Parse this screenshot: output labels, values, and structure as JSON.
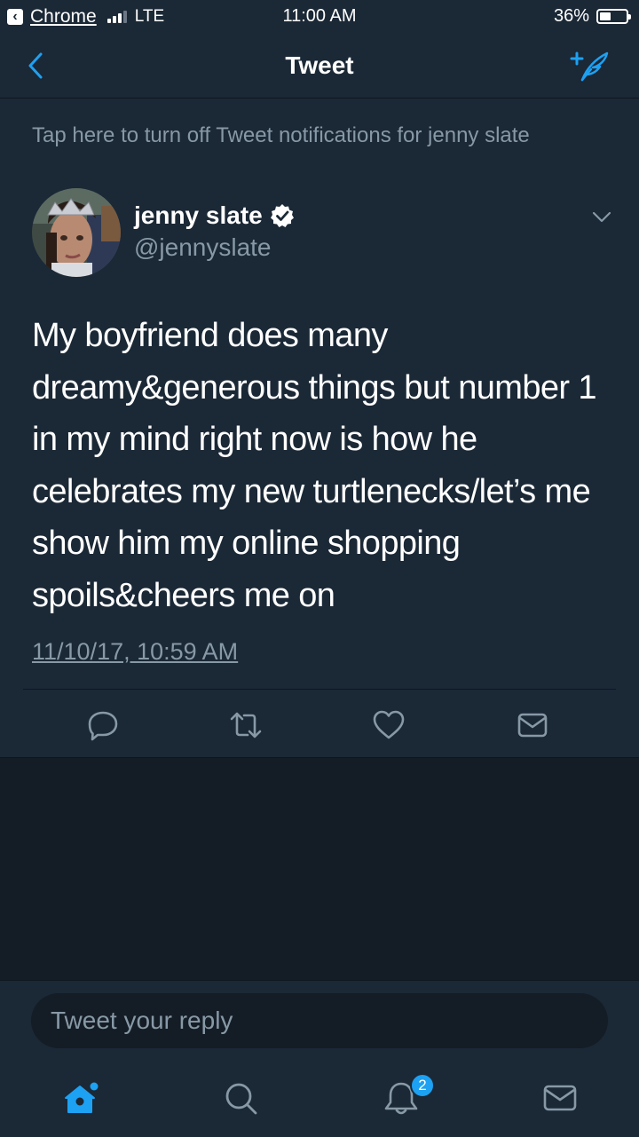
{
  "status_bar": {
    "back_app": "Chrome",
    "carrier": "LTE",
    "time": "11:00 AM",
    "battery": "36%",
    "battery_level": 0.36
  },
  "nav": {
    "title": "Tweet"
  },
  "notification_banner": "Tap here to turn off Tweet notifications for jenny slate",
  "tweet": {
    "author_name": "jenny slate",
    "author_handle": "@jennyslate",
    "text": "My boyfriend does many dreamy&generous things but number 1 in my mind right now is how he celebrates my new turtlenecks/let’s me show him my online shopping spoils&cheers me on",
    "timestamp": "11/10/17, 10:59 AM"
  },
  "reply": {
    "placeholder": "Tweet your reply"
  },
  "tab_bar": {
    "notification_count": "2"
  },
  "colors": {
    "background": "#141d26",
    "surface": "#1b2836",
    "accent": "#1da1f2",
    "secondary_text": "#8899a6"
  },
  "icons": [
    "chevron-left-icon",
    "compose-tweet-icon",
    "verified-badge-icon",
    "chevron-down-icon",
    "reply-icon",
    "retweet-icon",
    "heart-icon",
    "mail-icon",
    "home-icon",
    "search-icon",
    "bell-icon"
  ]
}
